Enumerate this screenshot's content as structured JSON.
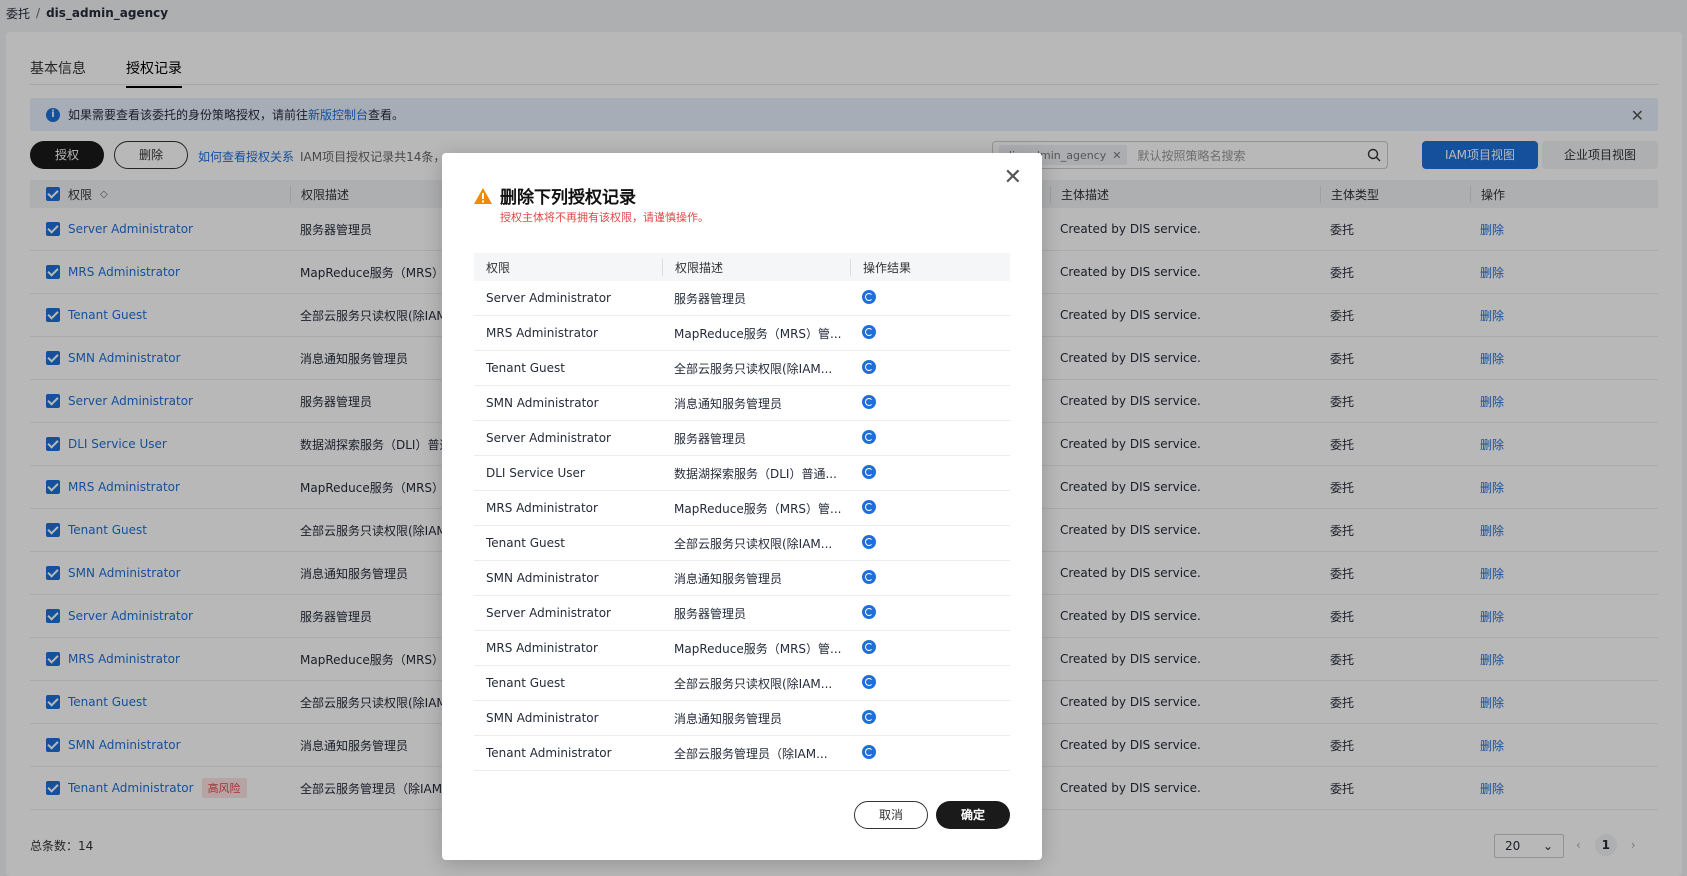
{
  "breadcrumb": {
    "parent": "委托",
    "separator": "/",
    "current": "dis_admin_agency"
  },
  "tabs": [
    {
      "label": "基本信息"
    },
    {
      "label": "授权记录"
    }
  ],
  "notice": {
    "text_before": "如果需要查看该委托的身份策略授权，请前往",
    "link": "新版控制台",
    "text_after": "查看。"
  },
  "toolbar": {
    "authorize_label": "授权",
    "delete_label": "删除",
    "help_link": "如何查看授权关系",
    "count_text": "IAM项目授权记录共14条，",
    "search": {
      "filter_tag_text": "dis_admin_agency",
      "placeholder": "默认按照策略名搜索"
    },
    "view_iam": "IAM项目视图",
    "view_enterprise": "企业项目视图"
  },
  "table": {
    "headers": {
      "permission": "权限",
      "permission_desc": "权限描述",
      "principal_desc": "主体描述",
      "principal_type": "主体类型",
      "action": "操作"
    },
    "rows": [
      {
        "permission": "Server Administrator",
        "desc": "服务器管理员",
        "principal_desc": "Created by DIS service.",
        "principal_type": "委托",
        "action": "删除"
      },
      {
        "permission": "MRS Administrator",
        "desc": "MapReduce服务（MRS）管",
        "principal_desc": "Created by DIS service.",
        "principal_type": "委托",
        "action": "删除"
      },
      {
        "permission": "Tenant Guest",
        "desc": "全部云服务只读权限(除IAM",
        "principal_desc": "Created by DIS service.",
        "principal_type": "委托",
        "action": "删除"
      },
      {
        "permission": "SMN Administrator",
        "desc": "消息通知服务管理员",
        "principal_desc": "Created by DIS service.",
        "principal_type": "委托",
        "action": "删除"
      },
      {
        "permission": "Server Administrator",
        "desc": "服务器管理员",
        "principal_desc": "Created by DIS service.",
        "principal_type": "委托",
        "action": "删除"
      },
      {
        "permission": "DLI Service User",
        "desc": "数据湖探索服务（DLI）普通",
        "principal_desc": "Created by DIS service.",
        "principal_type": "委托",
        "action": "删除"
      },
      {
        "permission": "MRS Administrator",
        "desc": "MapReduce服务（MRS）管",
        "principal_desc": "Created by DIS service.",
        "principal_type": "委托",
        "action": "删除"
      },
      {
        "permission": "Tenant Guest",
        "desc": "全部云服务只读权限(除IAM",
        "principal_desc": "Created by DIS service.",
        "principal_type": "委托",
        "action": "删除"
      },
      {
        "permission": "SMN Administrator",
        "desc": "消息通知服务管理员",
        "principal_desc": "Created by DIS service.",
        "principal_type": "委托",
        "action": "删除"
      },
      {
        "permission": "Server Administrator",
        "desc": "服务器管理员",
        "principal_desc": "Created by DIS service.",
        "principal_type": "委托",
        "action": "删除"
      },
      {
        "permission": "MRS Administrator",
        "desc": "MapReduce服务（MRS）管",
        "principal_desc": "Created by DIS service.",
        "principal_type": "委托",
        "action": "删除"
      },
      {
        "permission": "Tenant Guest",
        "desc": "全部云服务只读权限(除IAM",
        "principal_desc": "Created by DIS service.",
        "principal_type": "委托",
        "action": "删除"
      },
      {
        "permission": "SMN Administrator",
        "desc": "消息通知服务管理员",
        "principal_desc": "Created by DIS service.",
        "principal_type": "委托",
        "action": "删除"
      },
      {
        "permission": "Tenant Administrator",
        "badge": "高风险",
        "desc": "全部云服务管理员（除IAM管",
        "principal_desc": "Created by DIS service.",
        "principal_type": "委托",
        "action": "删除"
      }
    ]
  },
  "footer": {
    "total_label": "总条数：14",
    "page_size": "20",
    "current_page": "1"
  },
  "modal": {
    "title": "删除下列授权记录",
    "subtitle": "授权主体将不再拥有该权限，请谨慎操作。",
    "headers": {
      "permission": "权限",
      "desc": "权限描述",
      "result": "操作结果"
    },
    "rows": [
      {
        "permission": "Server Administrator",
        "desc": "服务器管理员"
      },
      {
        "permission": "MRS Administrator",
        "desc": "MapReduce服务（MRS）管..."
      },
      {
        "permission": "Tenant Guest",
        "desc": "全部云服务只读权限(除IAM..."
      },
      {
        "permission": "SMN Administrator",
        "desc": "消息通知服务管理员"
      },
      {
        "permission": "Server Administrator",
        "desc": "服务器管理员"
      },
      {
        "permission": "DLI Service User",
        "desc": "数据湖探索服务（DLI）普通..."
      },
      {
        "permission": "MRS Administrator",
        "desc": "MapReduce服务（MRS）管..."
      },
      {
        "permission": "Tenant Guest",
        "desc": "全部云服务只读权限(除IAM..."
      },
      {
        "permission": "SMN Administrator",
        "desc": "消息通知服务管理员"
      },
      {
        "permission": "Server Administrator",
        "desc": "服务器管理员"
      },
      {
        "permission": "MRS Administrator",
        "desc": "MapReduce服务（MRS）管..."
      },
      {
        "permission": "Tenant Guest",
        "desc": "全部云服务只读权限(除IAM..."
      },
      {
        "permission": "SMN Administrator",
        "desc": "消息通知服务管理员"
      },
      {
        "permission": "Tenant Administrator",
        "desc": "全部云服务管理员（除IAM..."
      }
    ],
    "cancel_label": "取消",
    "ok_label": "确定"
  },
  "colors": {
    "primary": "#1e6fd9",
    "danger": "#e04848",
    "dark_button": "#1a1a1a"
  }
}
